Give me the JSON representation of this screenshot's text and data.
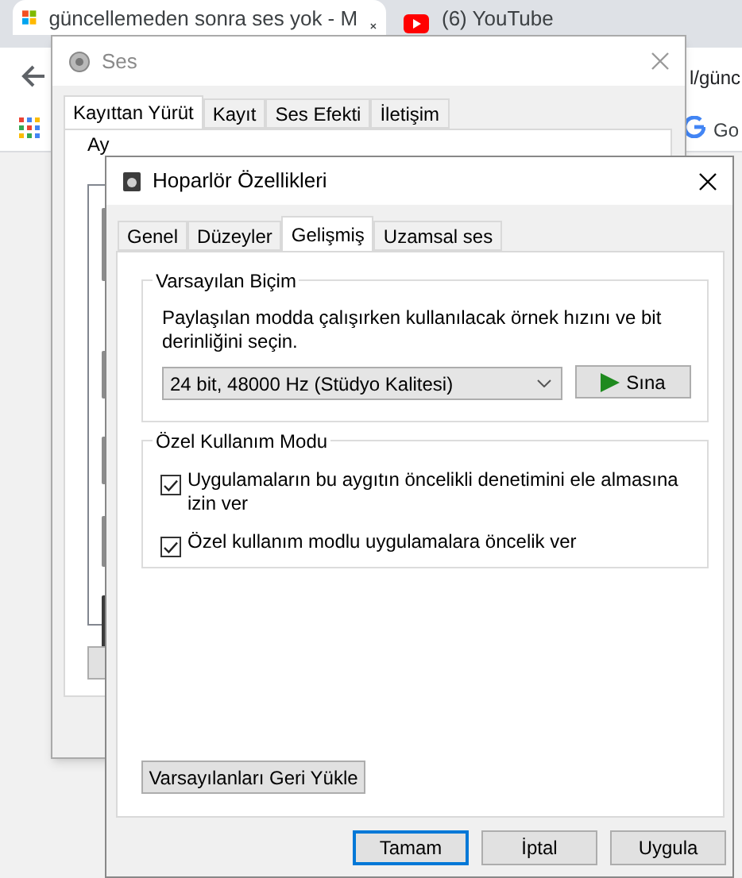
{
  "browser": {
    "tabs": [
      {
        "title": "güncellemeden sonra ses yok - M",
        "selected": true
      },
      {
        "title": "(6) YouTube",
        "selected": false
      }
    ],
    "address_fragment": "l/günc",
    "bookmark_fragment": "Go"
  },
  "sound_window": {
    "title": "Ses",
    "tabs": [
      {
        "label": "Kayıttan Yürüt",
        "selected": true
      },
      {
        "label": "Kayıt",
        "selected": false
      },
      {
        "label": "Ses Efekti",
        "selected": false
      },
      {
        "label": "İletişim",
        "selected": false
      }
    ],
    "instruction_fragment": "Ay"
  },
  "properties_window": {
    "title": "Hoparlör Özellikleri",
    "tabs": [
      {
        "label": "Genel",
        "selected": false
      },
      {
        "label": "Düzeyler",
        "selected": false
      },
      {
        "label": "Gelişmiş",
        "selected": true
      },
      {
        "label": "Uzamsal ses",
        "selected": false
      }
    ],
    "default_format": {
      "legend": "Varsayılan Biçim",
      "description": "Paylaşılan modda çalışırken kullanılacak örnek hızını ve bit derinliğini seçin.",
      "format": "24 bit, 48000 Hz (Stüdyo Kalitesi)",
      "test_button": "Sına"
    },
    "exclusive_mode": {
      "legend": "Özel Kullanım Modu",
      "options": [
        {
          "label": "Uygulamaların bu aygıtın öncelikli denetimini ele almasına izin ver",
          "checked": true
        },
        {
          "label": "Özel kullanım modlu uygulamalara öncelik ver",
          "checked": true
        }
      ]
    },
    "restore_button": "Varsayılanları Geri Yükle",
    "buttons": [
      {
        "label": "Tamam",
        "default": true
      },
      {
        "label": "İptal",
        "default": false
      },
      {
        "label": "Uygula",
        "default": false
      }
    ]
  }
}
